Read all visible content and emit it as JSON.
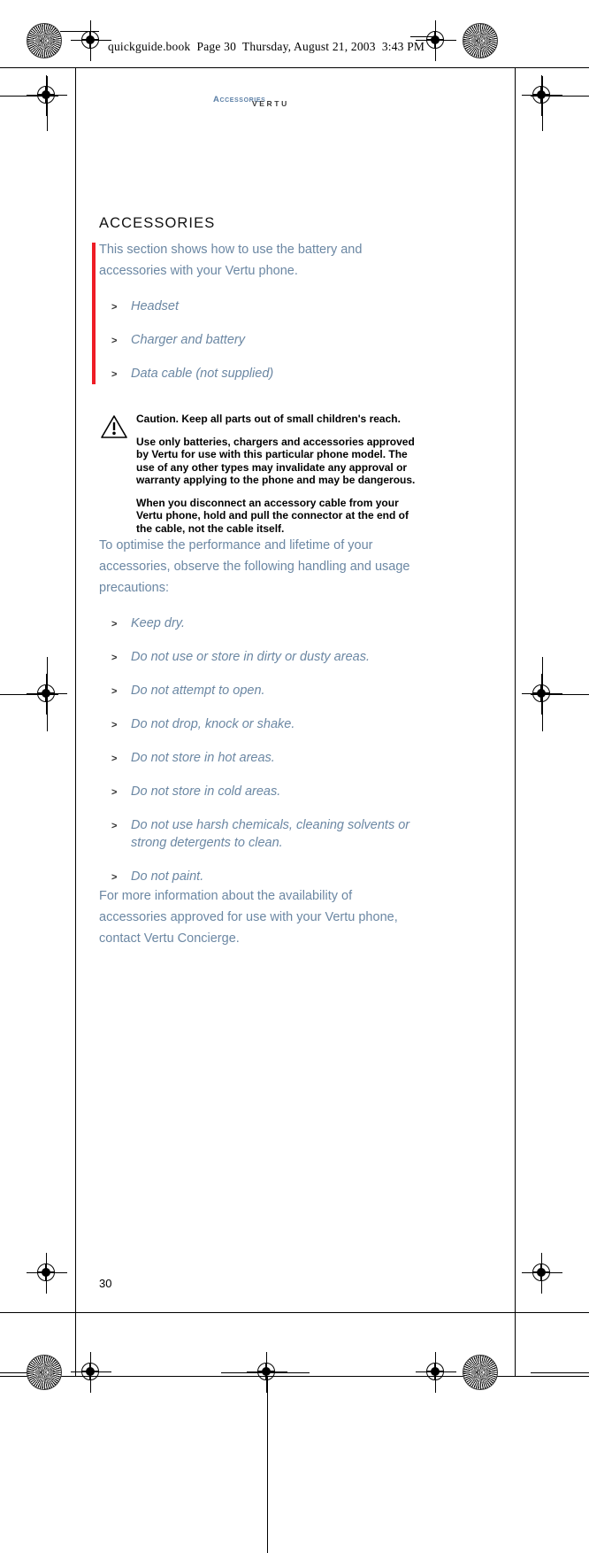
{
  "file_header": {
    "text": "quickguide.book  Page 30  Thursday, August 21, 2003  3:43 PM"
  },
  "running_head": {
    "section": "Accessories",
    "brand": "VERTU"
  },
  "page": {
    "chapter_title": "ACCESSORIES",
    "intro": "This section shows how to use the battery and accessories with your Vertu phone.",
    "intro_items": [
      "Headset",
      "Charger and battery",
      "Data cable (not supplied)"
    ],
    "caution": {
      "icon": "warning-triangle-icon",
      "heading": "Caution. Keep all parts out of small children's reach.",
      "paragraphs": [
        "Use only batteries, chargers and accessories approved by Vertu for use with this particular phone model. The use of any other types may invalidate any approval or warranty applying to the phone and may be dangerous.",
        "When you disconnect an accessory cable from your Vertu phone, hold and pull the connector at the end of the cable, not the cable itself."
      ]
    },
    "precautions_intro": "To optimise the performance and lifetime of your accessories, observe the following handling and usage precautions:",
    "precautions": [
      "Keep dry.",
      "Do not use or store in dirty or dusty areas.",
      "Do not attempt to open.",
      "Do not drop, knock or shake.",
      "Do not store in hot areas.",
      "Do not store in cold areas.",
      "Do not use harsh chemicals, cleaning solvents or strong detergents to clean.",
      "Do not paint."
    ],
    "closing": "For more information about the availability of accessories approved for use with your Vertu phone, contact Vertu Concierge.",
    "folio": "30",
    "bullet_marker": ">"
  },
  "colors": {
    "body_text": "#6b87a3",
    "change_bar": "#ee1c25",
    "running_head": "#5b7fa6",
    "brand": "#3a3a3a"
  }
}
